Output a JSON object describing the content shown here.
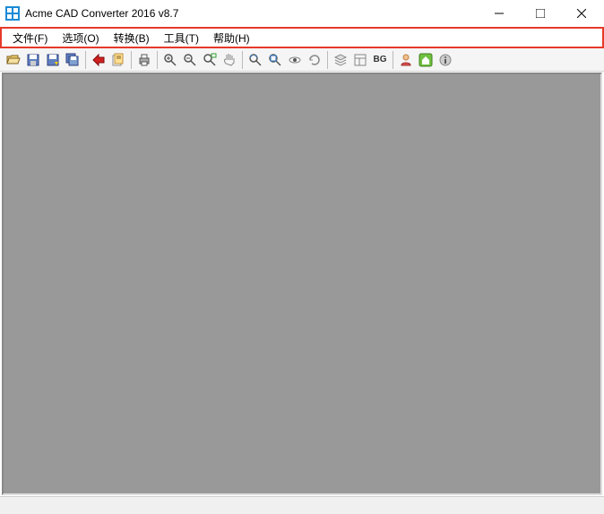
{
  "title": "Acme CAD Converter 2016 v8.7",
  "menu": {
    "file": "文件(F)",
    "options": "选项(O)",
    "convert": "转换(B)",
    "tools": "工具(T)",
    "help": "帮助(H)"
  },
  "toolbar": {
    "bg": "BG"
  }
}
